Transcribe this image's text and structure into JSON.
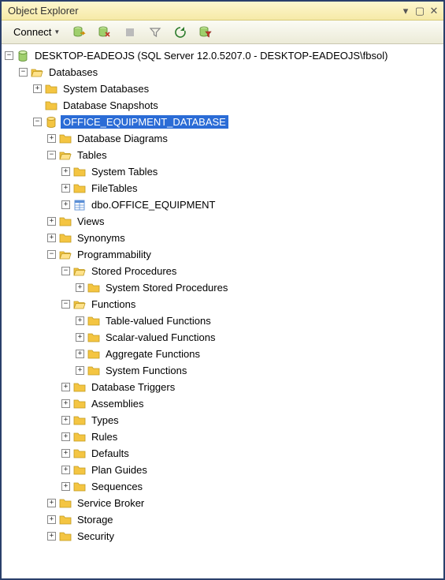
{
  "window": {
    "title": "Object Explorer"
  },
  "toolbar": {
    "connect": "Connect"
  },
  "tree": {
    "root": {
      "label": "DESKTOP-EADEOJS (SQL Server 12.0.5207.0 - DESKTOP-EADEOJS\\fbsol)",
      "databases": {
        "label": "Databases",
        "sysdb": "System Databases",
        "snapshots": "Database Snapshots",
        "oed": {
          "label": "OFFICE_EQUIPMENT_DATABASE",
          "diagrams": "Database Diagrams",
          "tables": {
            "label": "Tables",
            "systables": "System Tables",
            "filetables": "FileTables",
            "dbo_oe": "dbo.OFFICE_EQUIPMENT"
          },
          "views": "Views",
          "synonyms": "Synonyms",
          "prog": {
            "label": "Programmability",
            "sp": {
              "label": "Stored Procedures",
              "sys": "System Stored Procedures"
            },
            "fn": {
              "label": "Functions",
              "tvf": "Table-valued Functions",
              "svf": "Scalar-valued Functions",
              "agg": "Aggregate Functions",
              "sys": "System Functions"
            },
            "triggers": "Database Triggers",
            "assemblies": "Assemblies",
            "types": "Types",
            "rules": "Rules",
            "defaults": "Defaults",
            "planguides": "Plan Guides",
            "sequences": "Sequences"
          },
          "sbroker": "Service Broker",
          "storage": "Storage",
          "security": "Security"
        }
      }
    }
  }
}
